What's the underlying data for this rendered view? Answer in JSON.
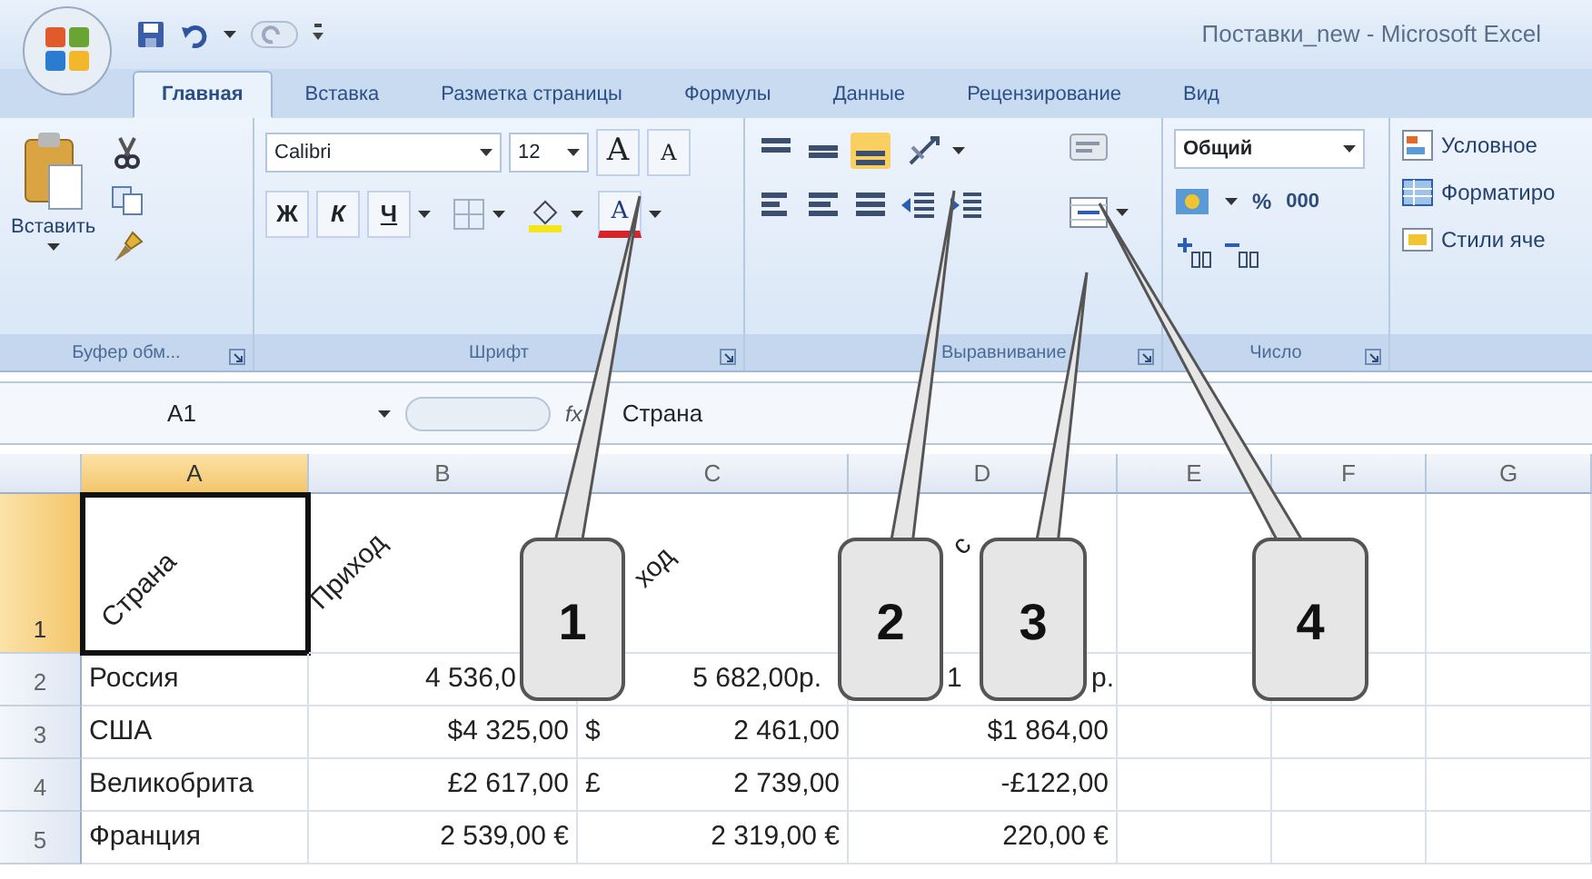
{
  "window": {
    "title": "Поставки_new - Microsoft Excel"
  },
  "tabs": [
    {
      "label": "Главная",
      "selected": true
    },
    {
      "label": "Вставка",
      "selected": false
    },
    {
      "label": "Разметка страницы",
      "selected": false
    },
    {
      "label": "Формулы",
      "selected": false
    },
    {
      "label": "Данные",
      "selected": false
    },
    {
      "label": "Рецензирование",
      "selected": false
    },
    {
      "label": "Вид",
      "selected": false
    }
  ],
  "ribbon": {
    "clipboard": {
      "paste_label": "Вставить",
      "group_label": "Буфер обм..."
    },
    "font": {
      "font_name": "Calibri",
      "font_size": "12",
      "grow": "A",
      "shrink": "A",
      "bold": "Ж",
      "italic": "К",
      "underline": "Ч",
      "font_color": "A",
      "group_label": "Шрифт"
    },
    "alignment": {
      "group_label": "Выравнивание"
    },
    "number": {
      "format": "Общий",
      "percent": "%",
      "thousands": "000",
      "group_label": "Число"
    },
    "styles": {
      "items": [
        "Условное",
        "Форматиро",
        "Стили яче"
      ]
    }
  },
  "formula_bar": {
    "name_box": "A1",
    "fx": "fx",
    "value": "Страна"
  },
  "sheet": {
    "columns": [
      {
        "label": "A",
        "selected": true
      },
      {
        "label": "B",
        "selected": false
      },
      {
        "label": "C",
        "selected": false
      },
      {
        "label": "D",
        "selected": false
      },
      {
        "label": "E",
        "selected": false
      },
      {
        "label": "F",
        "selected": false
      },
      {
        "label": "G",
        "selected": false
      }
    ],
    "rows": [
      {
        "label": "1",
        "selected": true,
        "cells": [
          "Страна",
          "Приход",
          "ход",
          "с"
        ]
      },
      {
        "label": "2",
        "selected": false,
        "cells": [
          "Россия",
          "4 536,0",
          "5 682,00р.",
          [
            "1",
            "р."
          ]
        ]
      },
      {
        "label": "3",
        "selected": false,
        "cells": [
          "США",
          "$4 325,00",
          [
            "$",
            "2 461,00"
          ],
          "$1 864,00"
        ]
      },
      {
        "label": "4",
        "selected": false,
        "cells": [
          "Великобрита",
          "£2 617,00",
          [
            "£",
            "2 739,00"
          ],
          "-£122,00"
        ]
      },
      {
        "label": "5",
        "selected": false,
        "cells": [
          "Франция",
          "2 539,00 €",
          "2 319,00 €",
          "220,00 €"
        ]
      }
    ]
  },
  "callouts": [
    "1",
    "2",
    "3",
    "4"
  ]
}
